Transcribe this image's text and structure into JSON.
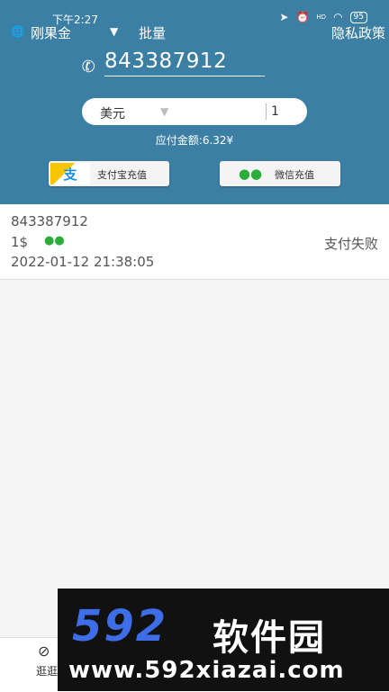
{
  "status_bar": {
    "time": "下午2:27",
    "battery": "95",
    "hd": "HD"
  },
  "topbar": {
    "country": "刚果金",
    "batch": "批量",
    "privacy": "隐私政策"
  },
  "recharge": {
    "phone_number": "843387912",
    "currency": "美元",
    "amount": "1",
    "amount_due": "应付金额:6.32¥",
    "alipay_button": "支付宝充值",
    "alipay_mark": "支",
    "wechat_button": "微信充值"
  },
  "records": [
    {
      "number": "843387912",
      "amount": "1$",
      "time": "2022-01-12 21:38:05",
      "status": "支付失败"
    }
  ],
  "tabbar": {
    "tab1_label": "逛逛"
  },
  "watermark": {
    "logo": "592",
    "cn": "软件园",
    "url": "www.592xiazai.com"
  },
  "colors": {
    "header": "#3c7fa4",
    "alipay": "#1a8fe0",
    "wechat": "#2aae39",
    "watermark_blue": "#3d6ee8"
  },
  "icons": [
    "globe-icon",
    "dropdown-triangle-icon",
    "phone-icon",
    "alipay-icon",
    "wechat-icon",
    "compass-icon",
    "location-icon",
    "alarm-icon",
    "wifi-icon",
    "battery-icon"
  ]
}
